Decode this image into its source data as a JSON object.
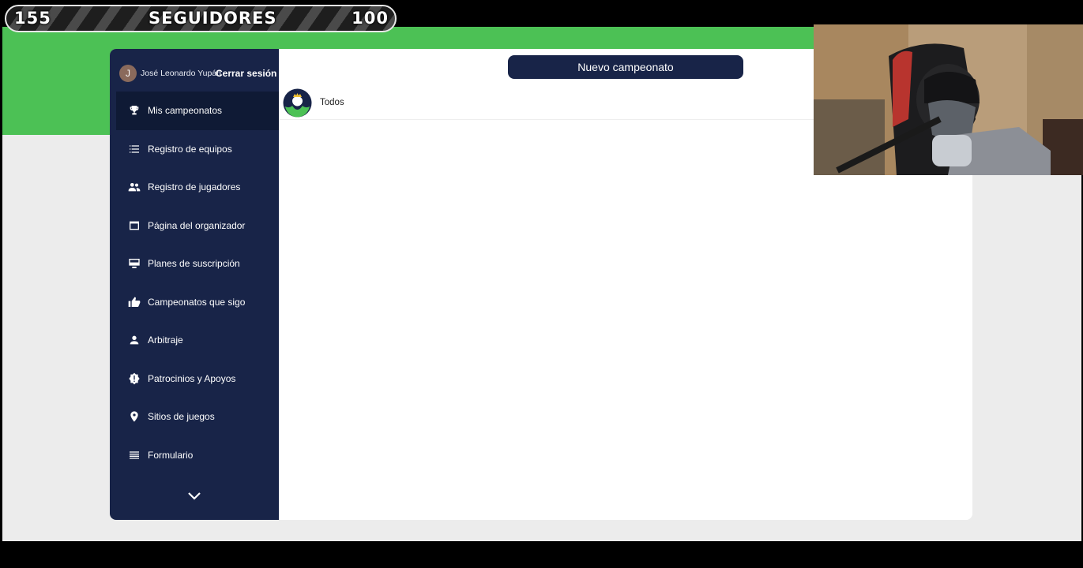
{
  "overlay": {
    "followers_current": "155",
    "followers_label": "SEGUIDORES",
    "followers_goal": "100"
  },
  "sidebar": {
    "user_initial": "J",
    "user_name": "José Leonardo Yupán Soria",
    "logout_label": "Cerrar sesión",
    "items": [
      {
        "label": "Mis campeonatos",
        "icon": "trophy-icon",
        "active": true
      },
      {
        "label": "Registro de equipos",
        "icon": "list-icon"
      },
      {
        "label": "Registro de jugadores",
        "icon": "people-icon"
      },
      {
        "label": "Página del organizador",
        "icon": "window-icon"
      },
      {
        "label": "Planes de suscripción",
        "icon": "monitor-icon"
      },
      {
        "label": "Campeonatos que sigo",
        "icon": "thumbs-up-icon"
      },
      {
        "label": "Arbitraje",
        "icon": "person-icon"
      },
      {
        "label": "Patrocinios y Apoyos",
        "icon": "badge-icon"
      },
      {
        "label": "Sitios de juegos",
        "icon": "map-pin-icon"
      },
      {
        "label": "Formulario",
        "icon": "lines-icon"
      }
    ],
    "more_icon": "chevron-down-icon"
  },
  "main": {
    "new_button_label": "Nuevo campeonato",
    "filter_label": "Todos",
    "filter_icon": "crown-logo-icon"
  },
  "colors": {
    "sidebar": "#182448",
    "band": "#4cc155",
    "button": "#182448"
  }
}
